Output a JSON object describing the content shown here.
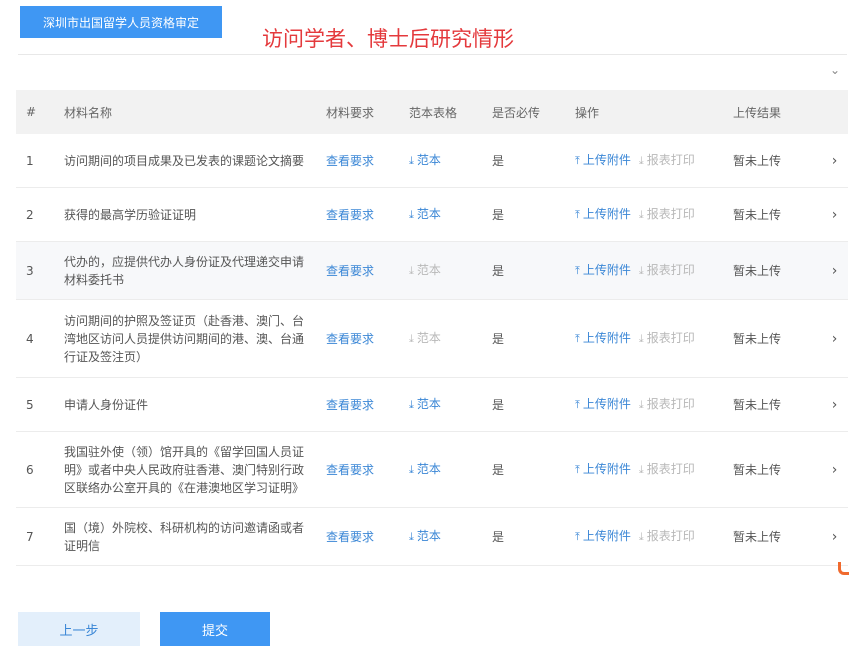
{
  "top_tab": "深圳市出国留学人员资格审定",
  "heading": "访问学者、博士后研究情形",
  "columns": {
    "num": "#",
    "name": "材料名称",
    "requirement": "材料要求",
    "template": "范本表格",
    "required": "是否必传",
    "operation": "操作",
    "result": "上传结果"
  },
  "rows": [
    {
      "num": "1",
      "name": "访问期间的项目成果及已发表的课题论文摘要",
      "requirement": "查看要求",
      "template": "范本",
      "required": "是",
      "upload": "上传附件",
      "print": "报表打印",
      "status": "暂未上传"
    },
    {
      "num": "2",
      "name": "获得的最高学历验证证明",
      "requirement": "查看要求",
      "template": "范本",
      "required": "是",
      "upload": "上传附件",
      "print": "报表打印",
      "status": "暂未上传"
    },
    {
      "num": "3",
      "name": "代办的，应提供代办人身份证及代理递交申请材料委托书",
      "requirement": "查看要求",
      "template": "范本",
      "required": "是",
      "upload": "上传附件",
      "print": "报表打印",
      "status": "暂未上传"
    },
    {
      "num": "4",
      "name": "访问期间的护照及签证页（赴香港、澳门、台湾地区访问人员提供访问期间的港、澳、台通行证及签注页）",
      "requirement": "查看要求",
      "template": "范本",
      "required": "是",
      "upload": "上传附件",
      "print": "报表打印",
      "status": "暂未上传"
    },
    {
      "num": "5",
      "name": "申请人身份证件",
      "requirement": "查看要求",
      "template": "范本",
      "required": "是",
      "upload": "上传附件",
      "print": "报表打印",
      "status": "暂未上传"
    },
    {
      "num": "6",
      "name": "我国驻外使（领）馆开具的《留学回国人员证明》或者中央人民政府驻香港、澳门特别行政区联络办公室开具的《在港澳地区学习证明》",
      "requirement": "查看要求",
      "template": "范本",
      "required": "是",
      "upload": "上传附件",
      "print": "报表打印",
      "status": "暂未上传"
    },
    {
      "num": "7",
      "name": "国（境）外院校、科研机构的访问邀请函或者证明信",
      "requirement": "查看要求",
      "template": "范本",
      "required": "是",
      "upload": "上传附件",
      "print": "报表打印",
      "status": "暂未上传"
    }
  ],
  "buttons": {
    "prev": "上一步",
    "submit": "提交"
  },
  "icons": {
    "collapse": "chevron-down-icon",
    "row_arrow": "chevron-right-icon",
    "download": "download-icon",
    "upload": "upload-icon"
  },
  "colors": {
    "primary": "#3f97f3",
    "link": "#3b87d6",
    "heading": "#e4393c",
    "status": "#e23b3b"
  }
}
